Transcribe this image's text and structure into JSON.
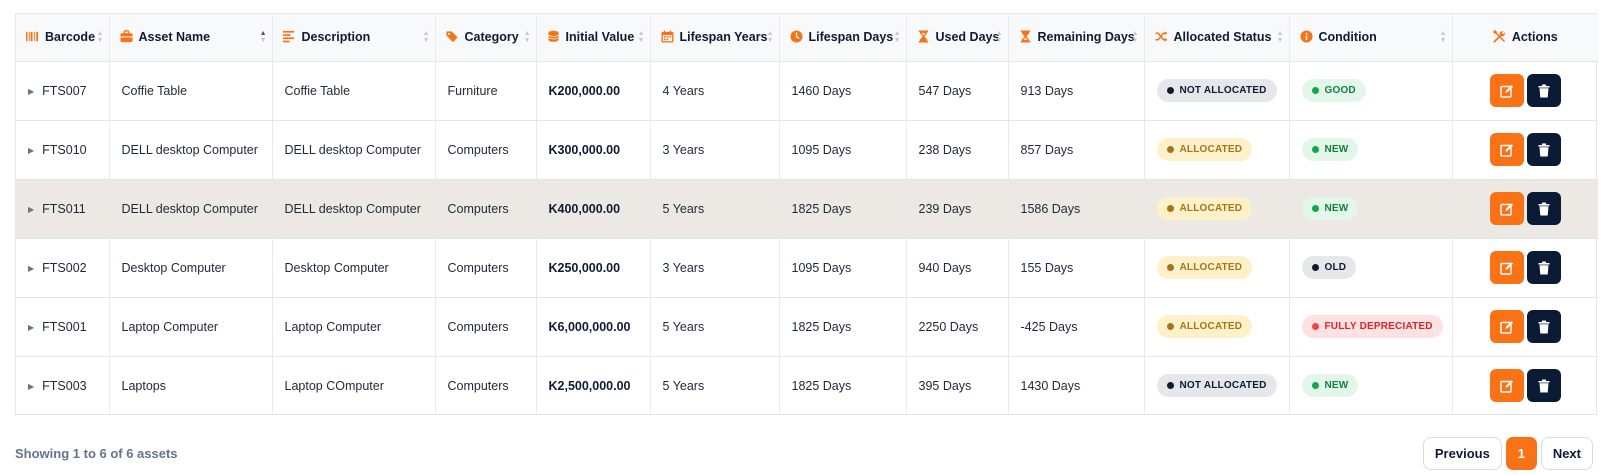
{
  "colors": {
    "accent": "#f97316",
    "dark": "#0b1b35",
    "highlight_row": "#ece8e4"
  },
  "table": {
    "columns": [
      {
        "key": "barcode",
        "label": "Barcode",
        "icon": "barcode-icon"
      },
      {
        "key": "asset_name",
        "label": "Asset Name",
        "icon": "briefcase-icon",
        "sorted": "asc"
      },
      {
        "key": "description",
        "label": "Description",
        "icon": "align-left-icon"
      },
      {
        "key": "category",
        "label": "Category",
        "icon": "tags-icon"
      },
      {
        "key": "initial_value",
        "label": "Initial Value",
        "icon": "coins-icon"
      },
      {
        "key": "lifespan_years",
        "label": "Lifespan Years",
        "icon": "calendar-icon"
      },
      {
        "key": "lifespan_days",
        "label": "Lifespan Days",
        "icon": "clock-icon"
      },
      {
        "key": "used_days",
        "label": "Used Days",
        "icon": "hourglass-start-icon"
      },
      {
        "key": "remaining_days",
        "label": "Remaining Days",
        "icon": "hourglass-end-icon"
      },
      {
        "key": "allocated_status",
        "label": "Allocated Status",
        "icon": "shuffle-icon"
      },
      {
        "key": "condition",
        "label": "Condition",
        "icon": "info-circle-icon"
      },
      {
        "key": "actions",
        "label": "Actions",
        "icon": "tools-icon"
      }
    ],
    "rows": [
      {
        "barcode": "FTS007",
        "asset_name": "Coffie Table",
        "description": "Coffie Table",
        "category": "Furniture",
        "initial_value": "K200,000.00",
        "lifespan_years": "4 Years",
        "lifespan_days": "1460 Days",
        "used_days": "547 Days",
        "remaining_days": "913 Days",
        "allocated_status": "NOT ALLOCATED",
        "condition": "GOOD"
      },
      {
        "barcode": "FTS010",
        "asset_name": "DELL desktop Computer",
        "description": "DELL desktop Computer",
        "category": "Computers",
        "initial_value": "K300,000.00",
        "lifespan_years": "3 Years",
        "lifespan_days": "1095 Days",
        "used_days": "238 Days",
        "remaining_days": "857 Days",
        "allocated_status": "ALLOCATED",
        "condition": "NEW"
      },
      {
        "barcode": "FTS011",
        "asset_name": "DELL desktop Computer",
        "description": "DELL desktop Computer",
        "category": "Computers",
        "initial_value": "K400,000.00",
        "lifespan_years": "5 Years",
        "lifespan_days": "1825 Days",
        "used_days": "239 Days",
        "remaining_days": "1586 Days",
        "allocated_status": "ALLOCATED",
        "condition": "NEW",
        "highlighted": true
      },
      {
        "barcode": "FTS002",
        "asset_name": "Desktop Computer",
        "description": "Desktop Computer",
        "category": "Computers",
        "initial_value": "K250,000.00",
        "lifespan_years": "3 Years",
        "lifespan_days": "1095 Days",
        "used_days": "940 Days",
        "remaining_days": "155 Days",
        "allocated_status": "ALLOCATED",
        "condition": "OLD"
      },
      {
        "barcode": "FTS001",
        "asset_name": "Laptop Computer",
        "description": "Laptop Computer",
        "category": "Computers",
        "initial_value": "K6,000,000.00",
        "lifespan_years": "5 Years",
        "lifespan_days": "1825 Days",
        "used_days": "2250 Days",
        "remaining_days": "-425 Days",
        "allocated_status": "ALLOCATED",
        "condition": "FULLY DEPRECIATED"
      },
      {
        "barcode": "FTS003",
        "asset_name": "Laptops",
        "description": "Laptop COmputer",
        "category": "Computers",
        "initial_value": "K2,500,000.00",
        "lifespan_years": "5 Years",
        "lifespan_days": "1825 Days",
        "used_days": "395 Days",
        "remaining_days": "1430 Days",
        "allocated_status": "NOT ALLOCATED",
        "condition": "NEW"
      }
    ],
    "row_action_icons": {
      "edit": "edit-icon",
      "delete": "trash-icon"
    },
    "row_expand_icon": "caret-right-icon"
  },
  "footer": {
    "info": "Showing 1 to 6 of 6 assets",
    "pagination": {
      "previous": "Previous",
      "current_page": "1",
      "next": "Next"
    }
  }
}
